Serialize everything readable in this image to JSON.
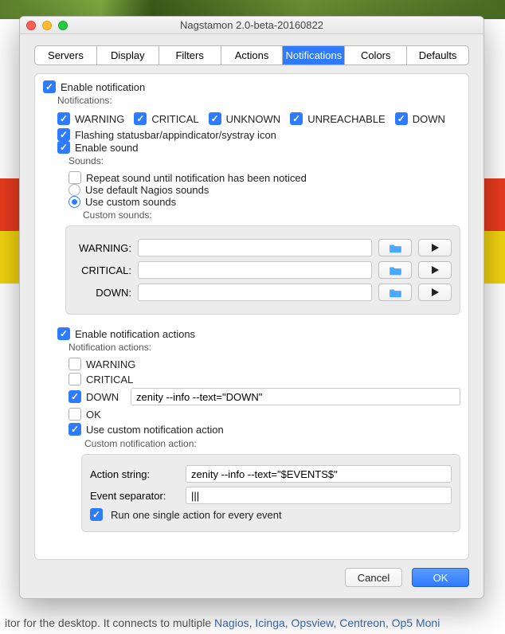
{
  "window": {
    "title": "Nagstamon 2.0-beta-20160822"
  },
  "tabs": [
    "Servers",
    "Display",
    "Filters",
    "Actions",
    "Notifications",
    "Colors",
    "Defaults"
  ],
  "active_tab": "Notifications",
  "enable_notification": {
    "label": "Enable notification",
    "sublabel": "Notifications:"
  },
  "types": [
    {
      "key": "warning",
      "label": "WARNING",
      "on": true
    },
    {
      "key": "critical",
      "label": "CRITICAL",
      "on": true
    },
    {
      "key": "unknown",
      "label": "UNKNOWN",
      "on": true
    },
    {
      "key": "unreachable",
      "label": "UNREACHABLE",
      "on": true
    },
    {
      "key": "down",
      "label": "DOWN",
      "on": true
    }
  ],
  "flashing": {
    "label": "Flashing statusbar/appindicator/systray icon"
  },
  "enable_sound": {
    "label": "Enable sound",
    "sublabel": "Sounds:"
  },
  "repeat_sound": {
    "label": "Repeat sound until notification has been noticed"
  },
  "default_sounds": {
    "label": "Use default Nagios sounds"
  },
  "custom_sounds": {
    "label": "Use custom sounds",
    "sublabel": "Custom sounds:"
  },
  "sound_rows": [
    {
      "key": "warning",
      "label": "WARNING:",
      "value": ""
    },
    {
      "key": "critical",
      "label": "CRITICAL:",
      "value": ""
    },
    {
      "key": "down",
      "label": "DOWN:",
      "value": ""
    }
  ],
  "enable_actions": {
    "label": "Enable notification actions",
    "sublabel": "Notification actions:"
  },
  "action_types": [
    {
      "key": "warning",
      "label": "WARNING",
      "on": false,
      "cmd": ""
    },
    {
      "key": "critical",
      "label": "CRITICAL",
      "on": false,
      "cmd": ""
    },
    {
      "key": "down",
      "label": "DOWN",
      "on": true,
      "cmd": "zenity --info --text=\"DOWN\""
    },
    {
      "key": "ok",
      "label": "OK",
      "on": false,
      "cmd": ""
    }
  ],
  "use_custom_action": {
    "label": "Use custom notification action",
    "sublabel": "Custom notification action:"
  },
  "custom_action": {
    "action_string_label": "Action string:",
    "action_string": "zenity --info --text=\"$EVENTS$\"",
    "event_sep_label": "Event separator:",
    "event_sep": "|||",
    "run_single_label": "Run one single action for every event"
  },
  "footer": {
    "cancel": "Cancel",
    "ok": "OK"
  },
  "bg": {
    "desc_prefix": "itor for the desktop. It connects to multiple ",
    "links": [
      "Nagios",
      "Icinga",
      "Opsview",
      "Centreon",
      "Op5 Moni"
    ]
  }
}
